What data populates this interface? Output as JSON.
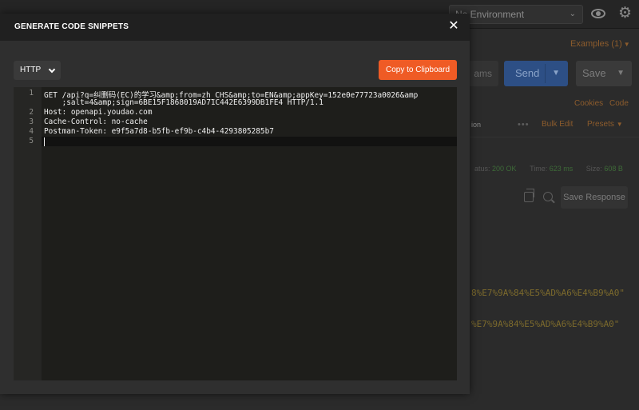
{
  "background": {
    "environment": "No Environment",
    "examples": "Examples (1)",
    "params": "ams",
    "send": "Send",
    "save": "Save",
    "cookies": "Cookies",
    "code": "Code",
    "tab_fragment": "ion",
    "bulk_edit": "Bulk Edit",
    "presets": "Presets",
    "status_label": "atus:",
    "status_value": "200 OK",
    "time_label": "Time:",
    "time_value": "623 ms",
    "size_label": "Size:",
    "size_value": "608 B",
    "save_response": "Save Response",
    "response_lines": [
      "8%E7%9A%84%E5%AD%A6%E4%B9%A0\"",
      "%E7%9A%84%E5%AD%A6%E4%B9%A0\""
    ]
  },
  "modal": {
    "title": "GENERATE CODE SNIPPETS",
    "close_label": "✕",
    "language": "HTTP",
    "copy_label": "Copy to Clipboard"
  },
  "editor": {
    "line_numbers": [
      "1",
      "",
      "2",
      "3",
      "4",
      "5"
    ],
    "lines": [
      "GET /api?q=纠删码(EC)的学习&amp;from=zh_CHS&amp;to=EN&amp;appKey=152e0e77723a0026&amp",
      "    ;salt=4&amp;sign=6BE15F1868019AD71C442E6399DB1FE4 HTTP/1.1",
      "Host: openapi.youdao.com",
      "Cache-Control: no-cache",
      "Postman-Token: e9f5a7d8-b5fb-ef9b-c4b4-4293805285b7",
      ""
    ]
  },
  "colors": {
    "accent": "#ef5b25",
    "header": "#202020",
    "editor_bg": "#1e1e1b"
  }
}
